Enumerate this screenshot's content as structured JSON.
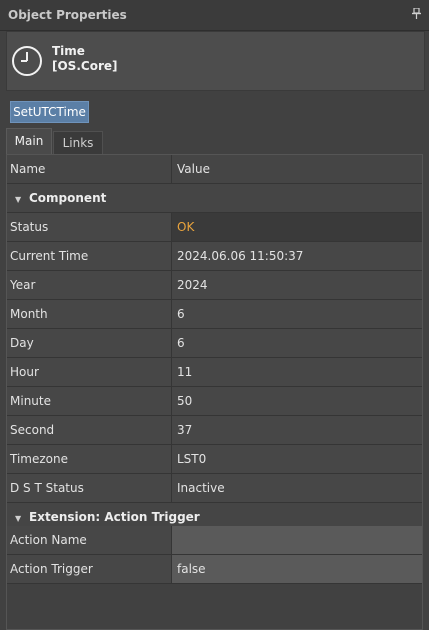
{
  "panel": {
    "title": "Object Properties"
  },
  "header": {
    "name": "Time",
    "namespace": "[OS.Core]",
    "icon": "clock-icon"
  },
  "action": {
    "label": "SetUTCTime"
  },
  "tabs": [
    {
      "label": "Main"
    },
    {
      "label": "Links"
    }
  ],
  "table": {
    "col_name": "Name",
    "col_value": "Value"
  },
  "groups": {
    "component": {
      "label": "Component",
      "rows": [
        {
          "name": "Status",
          "value": "OK"
        },
        {
          "name": "Current Time",
          "value": "2024.06.06 11:50:37"
        },
        {
          "name": "Year",
          "value": "2024"
        },
        {
          "name": "Month",
          "value": "6"
        },
        {
          "name": "Day",
          "value": "6"
        },
        {
          "name": "Hour",
          "value": "11"
        },
        {
          "name": "Minute",
          "value": "50"
        },
        {
          "name": "Second",
          "value": "37"
        },
        {
          "name": "Timezone",
          "value": "LST0"
        },
        {
          "name": "D S T Status",
          "value": "Inactive"
        }
      ]
    },
    "extension": {
      "label": "Extension: Action Trigger",
      "rows": [
        {
          "name": "Action Name",
          "value": ""
        },
        {
          "name": "Action Trigger",
          "value": "false"
        }
      ]
    }
  },
  "colors": {
    "status_ok": "#e8a33d",
    "button_bg": "#5b7fa6"
  }
}
